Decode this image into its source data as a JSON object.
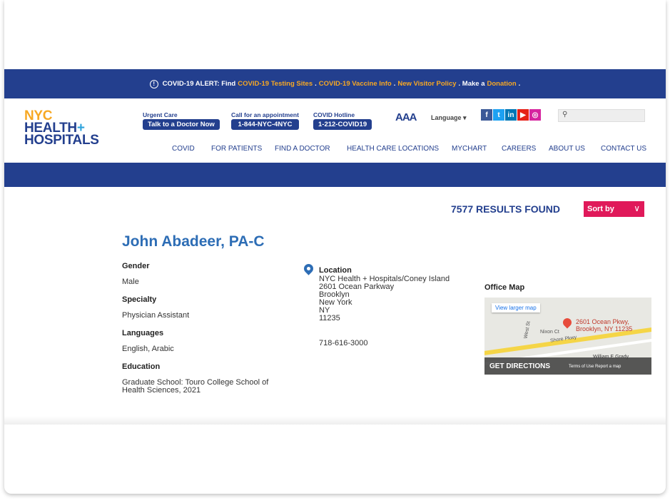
{
  "alert": {
    "prefix": "COVID-19 ALERT: Find",
    "link1": "COVID-19 Testing Sites",
    "sep1": ".",
    "link2": "COVID-19 Vaccine Info",
    "sep2": ".",
    "link3": "New Visitor Policy",
    "mid": ". Make a",
    "link4": "Donation",
    "end": "."
  },
  "logo": {
    "line1": "NYC",
    "line2": "HEALTH",
    "plus": "+",
    "line3": "HOSPITALS"
  },
  "utility": {
    "urgent_label": "Urgent Care",
    "urgent_button": "Talk to a Doctor Now",
    "appt_label": "Call for an appointment",
    "appt_button": "1-844-NYC-4NYC",
    "hotline_label": "COVID Hotline",
    "hotline_button": "1-212-COVID19",
    "text_size": "AAA",
    "language": "Language ▾",
    "social": [
      "f",
      "t",
      "in",
      "▶",
      "◎"
    ]
  },
  "nav": [
    "COVID",
    "FOR PATIENTS",
    "FIND A DOCTOR",
    "HEALTH CARE LOCATIONS",
    "MYCHART",
    "CAREERS",
    "ABOUT US",
    "CONTACT US"
  ],
  "results": {
    "count_text": "7577 RESULTS FOUND",
    "sort_label": "Sort by"
  },
  "doctor": {
    "name": "John Abadeer, PA-C",
    "gender_label": "Gender",
    "gender": "Male",
    "specialty_label": "Specialty",
    "specialty": "Physician Assistant",
    "languages_label": "Languages",
    "languages": "English, Arabic",
    "education_label": "Education",
    "education_line1": "Graduate School: Touro College School of",
    "education_line2": "Health Sciences, 2021"
  },
  "location": {
    "title": "Location",
    "lines": [
      "NYC Health + Hospitals/Coney Island",
      "2601 Ocean Parkway",
      "Brooklyn",
      "New York",
      "NY",
      "11235"
    ],
    "phone": "718-616-3000"
  },
  "map": {
    "title": "Office Map",
    "larger": "View larger map",
    "addr1": "2601 Ocean Pkwy,",
    "addr2": "Brooklyn, NY 11235",
    "street1": "Nixon Ct",
    "street2": "Shore Pkwy",
    "street3": "West St",
    "directions": "GET DIRECTIONS",
    "terms": "Terms of Use  Report a map",
    "grady": "William E Grady"
  },
  "colors": {
    "brand_blue": "#233f8e",
    "accent_orange": "#f7a823",
    "sort_pink": "#e0195a",
    "name_blue": "#2d6db5"
  }
}
